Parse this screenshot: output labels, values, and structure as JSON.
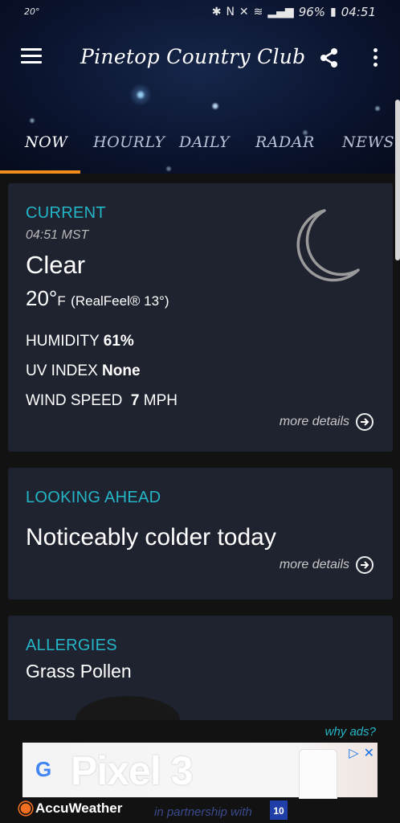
{
  "status_bar": {
    "left_text": "20°",
    "battery_text": "96%",
    "time": "04:51"
  },
  "toolbar": {
    "title": "Pinetop Country Club"
  },
  "tabs": [
    {
      "label": "NOW",
      "active": true
    },
    {
      "label": "HOURLY",
      "active": false
    },
    {
      "label": "DAILY",
      "active": false
    },
    {
      "label": "RADAR",
      "active": false
    },
    {
      "label": "NEWS",
      "active": false
    }
  ],
  "current": {
    "label": "CURRENT",
    "time": "04:51 MST",
    "condition": "Clear",
    "temp": "20°",
    "temp_unit": "F",
    "realfeel": "(RealFeel® 13°)",
    "humidity_label": "HUMIDITY",
    "humidity_value": "61%",
    "uv_label": "UV INDEX",
    "uv_value": "None",
    "wind_label": "WIND SPEED",
    "wind_value": "7",
    "wind_unit": "MPH",
    "more_details": "more details",
    "icon": "moon-icon"
  },
  "looking_ahead": {
    "label": "LOOKING AHEAD",
    "summary": "Noticeably colder today",
    "more_details": "more details"
  },
  "allergies": {
    "label": "ALLERGIES",
    "item": "Grass Pollen"
  },
  "ad": {
    "why_ads": "why ads?",
    "banner_text": "Pixel 3",
    "brand": "AccuWeather",
    "partner_text": "in partnership with",
    "partner_logo": "10"
  },
  "colors": {
    "accent": "#24b5c7",
    "tab_indicator": "#f28c1b",
    "card_bg": "#1f2330"
  }
}
